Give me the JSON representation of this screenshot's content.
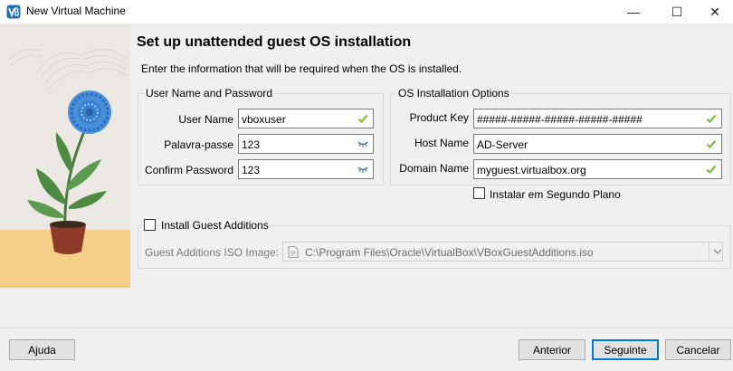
{
  "window": {
    "title": "New Virtual Machine",
    "minimize_glyph": "—",
    "maximize_glyph": "☐",
    "close_glyph": "✕"
  },
  "page": {
    "heading": "Set up unattended guest OS installation",
    "subheading": "Enter the information that will be required when the OS is installed."
  },
  "user_group": {
    "legend": "User Name and Password",
    "username_label": "User Name",
    "username_value": "vboxuser",
    "password_label": "Palavra-passe",
    "password_value": "123",
    "confirm_label": "Confirm Password",
    "confirm_value": "123"
  },
  "os_group": {
    "legend": "OS Installation Options",
    "product_key_label": "Product Key",
    "product_key_value": "#####-#####-#####-#####-#####",
    "hostname_label": "Host Name",
    "hostname_value": "AD-Server",
    "domain_label": "Domain Name",
    "domain_value": "myguest.virtualbox.org",
    "background_label": "Instalar em Segundo Plano",
    "background_checked": false
  },
  "guest_additions": {
    "install_label": "Install Guest Additions",
    "install_checked": false,
    "iso_label": "Guest Additions ISO Image:",
    "iso_value": "C:\\Program Files\\Oracle\\VirtualBox\\VBoxGuestAdditions.iso"
  },
  "buttons": {
    "help": "Ajuda",
    "back": "Anterior",
    "next": "Seguinte",
    "cancel": "Cancelar"
  },
  "icons": {
    "valid": "check-icon",
    "password_reveal": "eye-closed-icon",
    "app": "virtualbox-icon",
    "file": "file-icon",
    "dropdown": "chevron-down-icon"
  },
  "colors": {
    "valid_check": "#7bbf3a",
    "eye_icon": "#2b6fbf",
    "default_button_border": "#0078d7"
  }
}
